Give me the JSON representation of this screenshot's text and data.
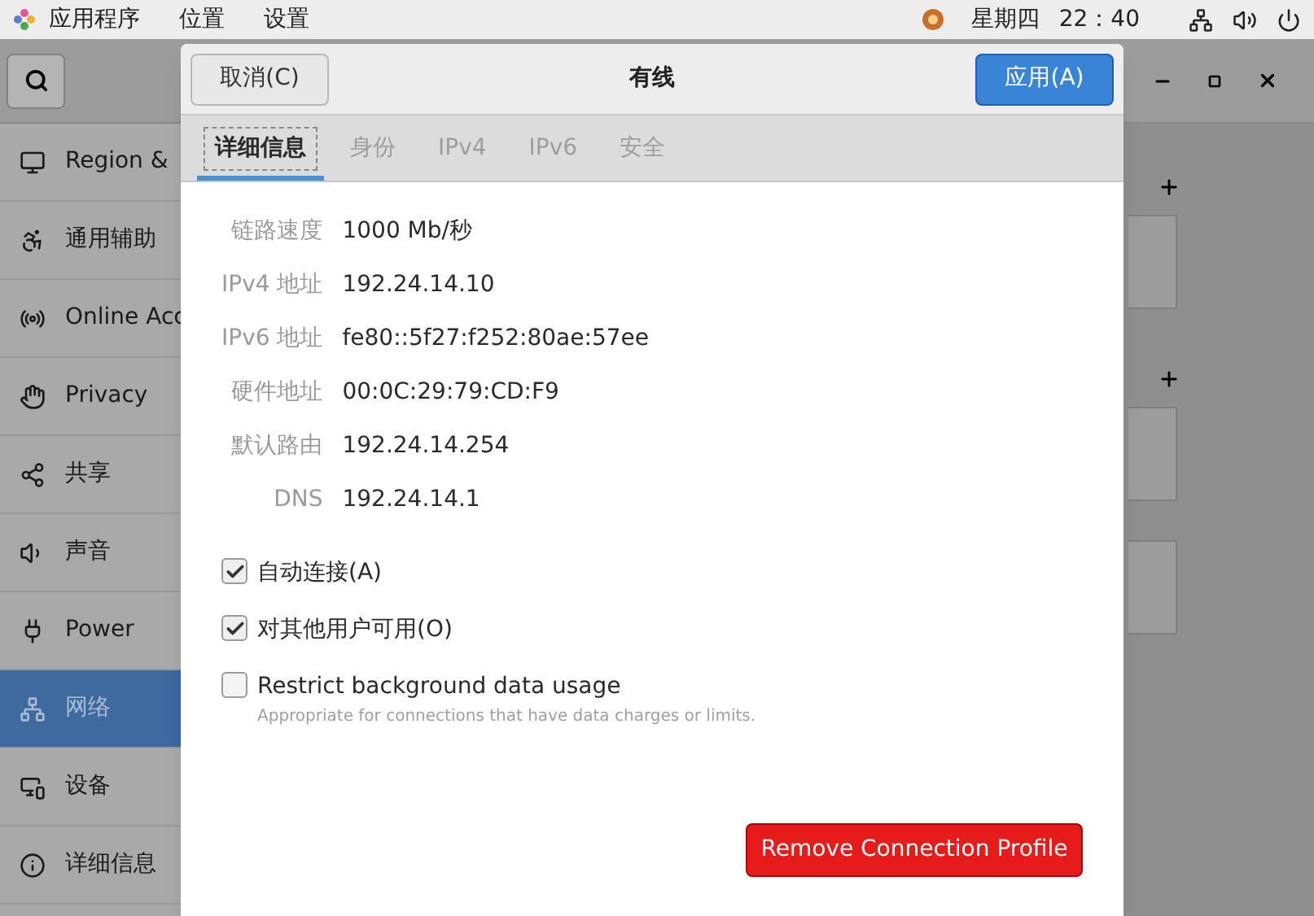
{
  "top_bar": {
    "menus": [
      "应用程序",
      "位置",
      "设置"
    ],
    "day": "星期四",
    "time": "22：40"
  },
  "settings_window": {
    "sidebar": {
      "items": [
        {
          "label": "Region &",
          "selected": false
        },
        {
          "label": "通用辅助",
          "selected": false
        },
        {
          "label": "Online Acc",
          "selected": false
        },
        {
          "label": "Privacy",
          "selected": false
        },
        {
          "label": "共享",
          "selected": false
        },
        {
          "label": "声音",
          "selected": false
        },
        {
          "label": "Power",
          "selected": false
        },
        {
          "label": "网络",
          "selected": true
        },
        {
          "label": "设备",
          "selected": false
        },
        {
          "label": "详细信息",
          "selected": false
        }
      ]
    }
  },
  "dialog": {
    "title": "有线",
    "cancel_button": "取消(C)",
    "apply_button": "应用(A)",
    "tabs": [
      {
        "label": "详细信息",
        "selected": true
      },
      {
        "label": "身份",
        "selected": false
      },
      {
        "label": "IPv4",
        "selected": false
      },
      {
        "label": "IPv6",
        "selected": false
      },
      {
        "label": "安全",
        "selected": false
      }
    ],
    "details": [
      {
        "label": "链路速度",
        "value": "1000 Mb/秒"
      },
      {
        "label": "IPv4 地址",
        "value": "192.24.14.10"
      },
      {
        "label": "IPv6 地址",
        "value": "fe80::5f27:f252:80ae:57ee"
      },
      {
        "label": "硬件地址",
        "value": "00:0C:29:79:CD:F9"
      },
      {
        "label": "默认路由",
        "value": "192.24.14.254"
      },
      {
        "label": "DNS",
        "value": "192.24.14.1"
      }
    ],
    "options": [
      {
        "label": "自动连接(A)",
        "checked": true
      },
      {
        "label": "对其他用户可用(O)",
        "checked": true
      },
      {
        "label": "Restrict background data usage",
        "description": "Appropriate for connections that have data charges or limits.",
        "checked": false
      }
    ],
    "remove_button": "Remove Connection Profile"
  }
}
